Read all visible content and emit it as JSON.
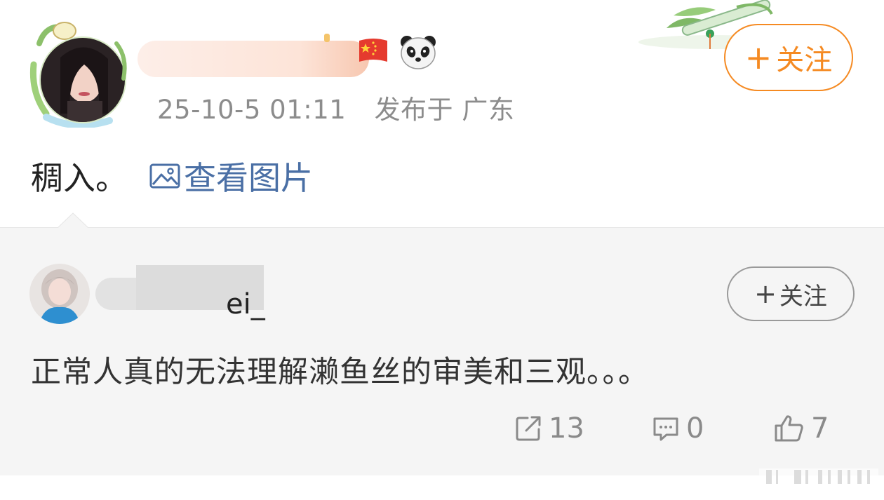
{
  "post": {
    "timestamp": "25-10-5 01:11",
    "location": "发布于 广东",
    "body_text": "稠入。",
    "view_image_link": "查看图片",
    "follow_button": {
      "plus": "+",
      "label": "关注"
    }
  },
  "reply": {
    "name_visible_fragment": "ei_",
    "text": "正常人真的无法理解濑鱼丝的审美和三观。。。",
    "follow_button": {
      "plus": "+",
      "label": "关注"
    },
    "actions": {
      "share_count": "13",
      "comment_count": "0",
      "like_count": "7"
    }
  },
  "icons": {
    "flag": "china-flag-icon",
    "panda": "panda-icon",
    "image": "image-icon",
    "share": "share-icon",
    "comment": "comment-icon",
    "like": "thumbs-up-icon"
  },
  "colors": {
    "accent_orange": "#f58a22",
    "link_blue": "#4a6fa5",
    "meta_gray": "#8c8c8c",
    "card_bg": "#f5f5f5"
  }
}
